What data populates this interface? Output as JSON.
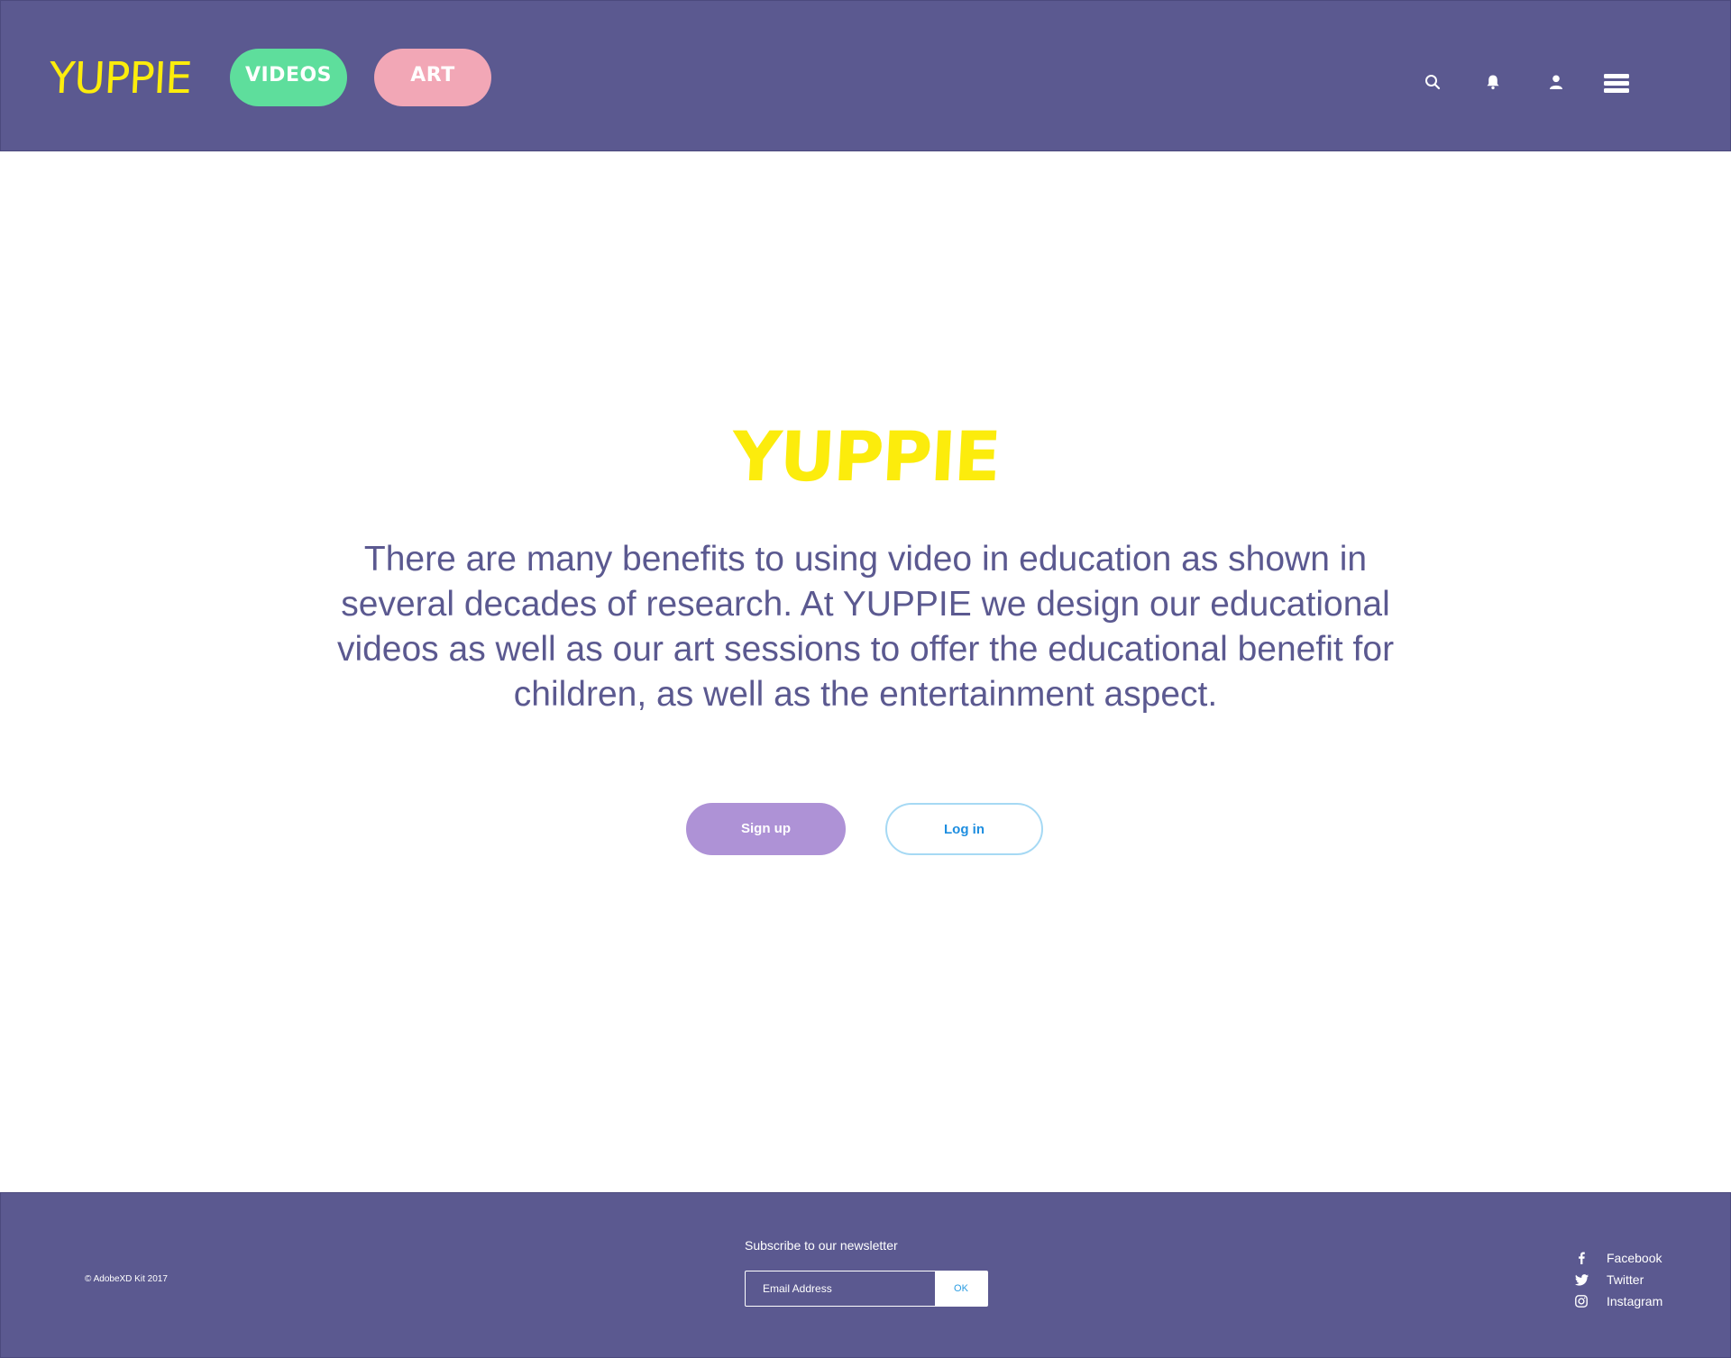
{
  "header": {
    "logo": "YUPPIE",
    "nav": [
      {
        "label": "VIDEOS"
      },
      {
        "label": "ART"
      }
    ],
    "icons": [
      "search-icon",
      "bell-icon",
      "user-icon",
      "menu-icon"
    ]
  },
  "hero": {
    "title": "YUPPIE",
    "text": "There are many benefits to using video in education as shown in several decades of research. At YUPPIE we design our educational videos as well as our art sessions to offer the educational benefit for children, as well as the entertainment aspect.",
    "signup_label": "Sign up",
    "login_label": "Log in"
  },
  "footer": {
    "copyright": "© AdobeXD Kit 2017",
    "newsletter": {
      "label": "Subscribe to our newsletter",
      "placeholder": "Email Address",
      "submit_label": "OK"
    },
    "social": [
      {
        "label": "Facebook",
        "icon": "facebook-icon"
      },
      {
        "label": "Twitter",
        "icon": "twitter-icon"
      },
      {
        "label": "Instagram",
        "icon": "instagram-icon"
      }
    ]
  },
  "colors": {
    "primary": "#5b5990",
    "logo": "#fcec0c",
    "videos": "#5ede9c",
    "art": "#f2a7b6",
    "signup": "#ae92d6",
    "login_border": "#a6d9f4",
    "link_blue": "#1e8ee0"
  }
}
